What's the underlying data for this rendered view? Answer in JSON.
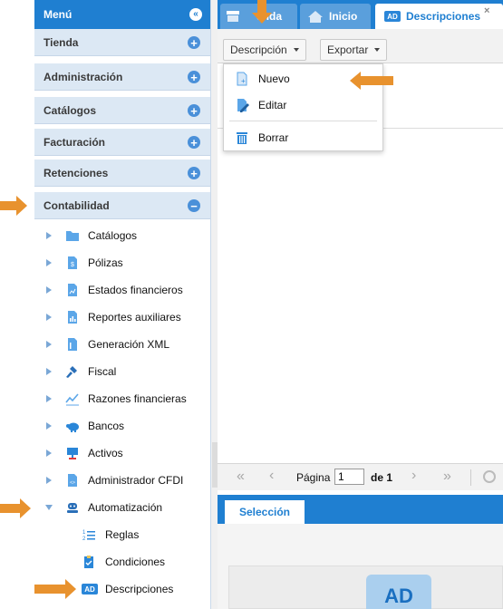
{
  "sidebar": {
    "title": "Menú",
    "sections": [
      {
        "label": "Tienda"
      },
      {
        "label": "Administración"
      },
      {
        "label": "Catálogos"
      },
      {
        "label": "Facturación"
      },
      {
        "label": "Retenciones"
      },
      {
        "label": "Contabilidad"
      }
    ],
    "items": [
      {
        "label": "Catálogos",
        "icon": "folder-icon"
      },
      {
        "label": "Pólizas",
        "icon": "document-icon"
      },
      {
        "label": "Estados financieros",
        "icon": "report-icon"
      },
      {
        "label": "Reportes auxiliares",
        "icon": "bar-chart-icon"
      },
      {
        "label": "Generación XML",
        "icon": "xml-file-icon"
      },
      {
        "label": "Fiscal",
        "icon": "gavel-icon"
      },
      {
        "label": "Razones financieras",
        "icon": "trend-icon"
      },
      {
        "label": "Bancos",
        "icon": "piggy-bank-icon"
      },
      {
        "label": "Activos",
        "icon": "monitor-icon"
      },
      {
        "label": "Administrador CFDI",
        "icon": "cfdi-file-icon"
      },
      {
        "label": "Automatización",
        "icon": "robot-icon"
      }
    ],
    "subitems": [
      {
        "label": "Reglas",
        "icon": "list-icon"
      },
      {
        "label": "Condiciones",
        "icon": "clipboard-icon"
      },
      {
        "label": "Descripciones",
        "icon": "ad-icon",
        "badge": "AD"
      }
    ]
  },
  "tabs": {
    "tienda": "enda",
    "inicio": "Inicio",
    "descripciones": "Descripciones",
    "descripciones_badge": "AD",
    "close": "×"
  },
  "toolbar": {
    "descripcion": "Descripción",
    "exportar": "Exportar"
  },
  "dropdown": {
    "nuevo": "Nuevo",
    "editar": "Editar",
    "borrar": "Borrar"
  },
  "pager": {
    "first": "«",
    "prev": "‹",
    "page_label": "Página",
    "page_value": "1",
    "of_label": "de 1",
    "next": "›",
    "last": "»"
  },
  "selection": {
    "tab": "Selección",
    "card_badge": "AD"
  },
  "colors": {
    "accent": "#1f7fd1",
    "section_bg": "#dce8f4",
    "pointer": "#e8922e"
  }
}
